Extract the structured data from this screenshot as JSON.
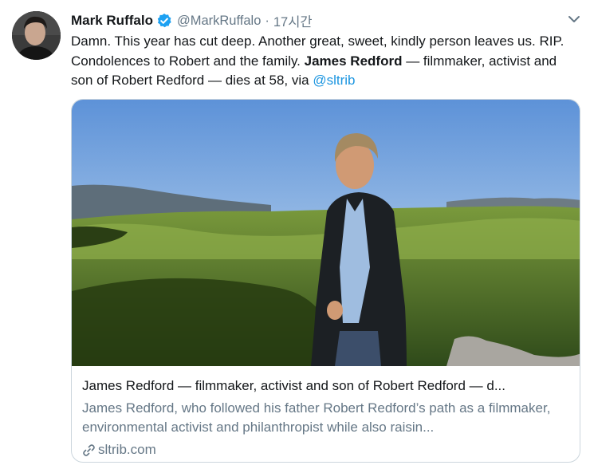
{
  "tweet": {
    "author_name": "Mark Ruffalo",
    "author_handle": "@MarkRuffalo",
    "separator": "·",
    "time": "17시간",
    "text_part1": "Damn. This year has cut deep. Another great, sweet, kindly person leaves us. RIP. Condolences to Robert and the family. ",
    "text_bold": "James Redford",
    "text_part2": " — filmmaker, activist and son of Robert Redford — dies at 58, via ",
    "text_mention": "@sltrib"
  },
  "card": {
    "title": "James Redford — filmmaker, activist and son of Robert Redford — d...",
    "description": "James Redford, who followed his father Robert Redford’s path as a filmmaker, environmental activist and philanthropist while also raisin...",
    "domain": "sltrib.com"
  },
  "icons": {
    "verified": "verified-badge-icon",
    "menu": "chevron-down-icon",
    "link": "link-icon"
  },
  "colors": {
    "link_blue": "#1b95e0",
    "verified_blue": "#1da1f2",
    "secondary_text": "#657786",
    "border": "#ccd6dd"
  }
}
